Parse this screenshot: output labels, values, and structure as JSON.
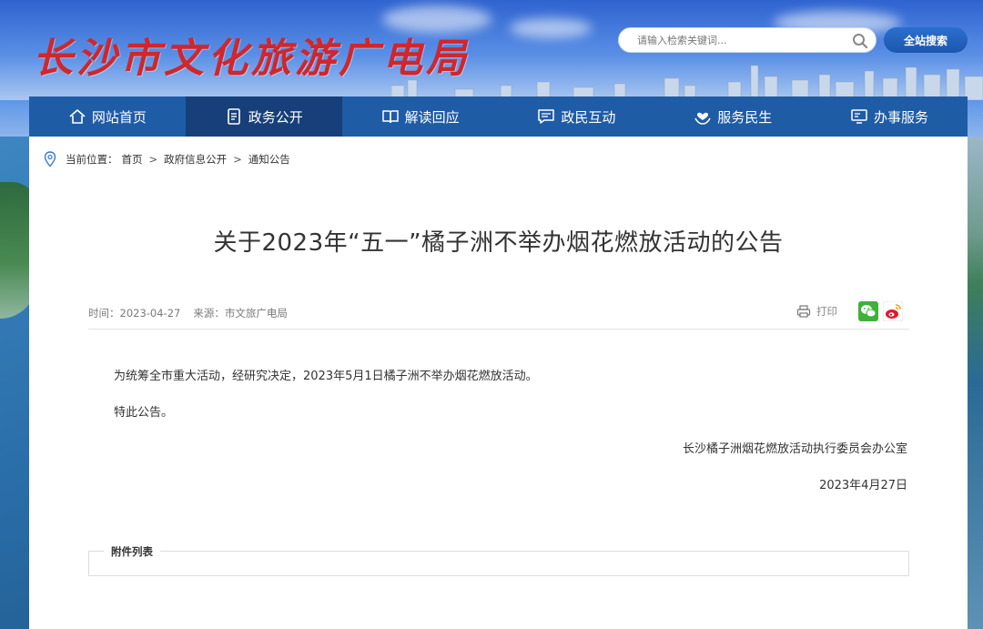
{
  "header": {
    "logo_text": "长沙市文化旅游广电局",
    "search_placeholder": "请输入检索关键词...",
    "search_button": "全站搜索"
  },
  "nav": {
    "items": [
      {
        "label": "网站首页",
        "icon": "home-icon"
      },
      {
        "label": "政务公开",
        "icon": "document-icon"
      },
      {
        "label": "解读回应",
        "icon": "book-icon"
      },
      {
        "label": "政民互动",
        "icon": "chat-icon"
      },
      {
        "label": "服务民生",
        "icon": "heart-hands-icon"
      },
      {
        "label": "办事服务",
        "icon": "monitor-icon"
      }
    ],
    "active_index": 1
  },
  "breadcrumb": {
    "prefix": "当前位置：",
    "items": [
      "首页",
      "政府信息公开",
      "通知公告"
    ],
    "separator": ">"
  },
  "article": {
    "title": "关于2023年“五一”橘子洲不举办烟花燃放活动的公告",
    "time_label": "时间：2023-04-27",
    "source_label": "来源：市文旅广电局",
    "print_label": "打印",
    "paragraphs": [
      "为统筹全市重大活动，经研究决定，2023年5月1日橘子洲不举办烟花燃放活动。",
      "特此公告。"
    ],
    "signature": "长沙橘子洲烟花燃放活动执行委员会办公室",
    "date": "2023年4月27日"
  },
  "attachments": {
    "label": "附件列表"
  },
  "colors": {
    "nav_bg": "#1f5ca6",
    "nav_active_bg": "#173f7a",
    "logo_red": "#d1262a",
    "search_button_bg": "#1c57ad"
  }
}
